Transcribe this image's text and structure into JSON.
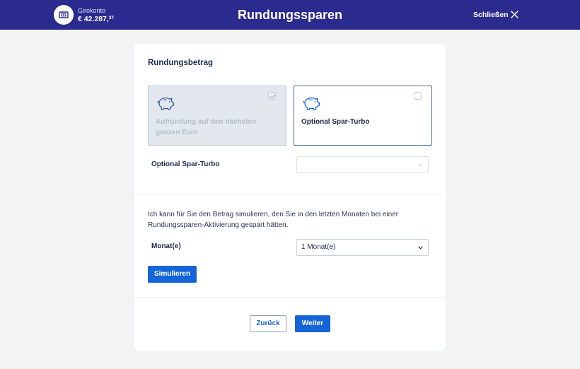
{
  "header": {
    "account_label": "Girokonto",
    "account_balance_main": "€ 42.287,",
    "account_balance_cents": "37",
    "title": "Rundungssparen",
    "close_label": "Schließen"
  },
  "card": {
    "section_title": "Rundungsbetrag",
    "tiles": [
      {
        "label": "Aufrundung auf den nächsten ganzen Euro",
        "checked": true,
        "disabled": true
      },
      {
        "label": "Optional Spar-Turbo",
        "checked": false,
        "disabled": false
      }
    ],
    "turbo_field": {
      "label": "Optional Spar-Turbo",
      "value": ""
    },
    "description": "Ich kann für Sie den Betrag simulieren, den Sie in den letzten Monaten bei einer Rundungssparen-Aktivierung gespart hätten.",
    "months_field": {
      "label": "Monat(e)",
      "value": "1 Monat(e)"
    },
    "simulate_label": "Simulieren",
    "back_label": "Zurück",
    "next_label": "Weiter"
  },
  "colors": {
    "header_bg": "#2b2b8f",
    "primary": "#1565d8",
    "background": "#f2f3f5"
  },
  "icons": [
    "wallet-icon",
    "close-icon",
    "piggy-bank-icon",
    "checkmark-icon",
    "chevron-down-icon"
  ]
}
